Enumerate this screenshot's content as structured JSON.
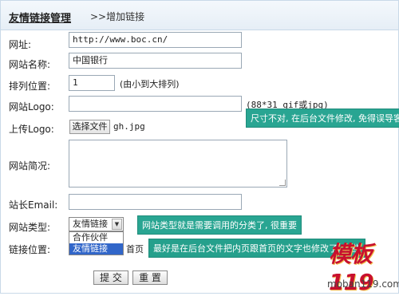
{
  "header": {
    "title": "友情链接管理",
    "subtitle": ">>增加链接"
  },
  "fields": {
    "url": {
      "label": "网址:",
      "value": "http://www.boc.cn/"
    },
    "site_name": {
      "label": "网站名称:",
      "value": "中国银行"
    },
    "order": {
      "label": "排列位置:",
      "value": "1",
      "hint": "(由小到大排列)"
    },
    "logo": {
      "label": "网站Logo:",
      "value": "",
      "hint": "(88*31 gif或jpg)"
    },
    "upload": {
      "label": "上传Logo:",
      "button": "选择文件",
      "filename": "gh.jpg"
    },
    "intro": {
      "label": "网站简况:",
      "value": ""
    },
    "email": {
      "label": "站长Email:",
      "value": ""
    },
    "type": {
      "label": "网站类型:",
      "selected": "友情链接",
      "options": [
        "合作伙伴",
        "友情链接"
      ]
    },
    "position": {
      "label": "链接位置:",
      "radio_label": "首页"
    }
  },
  "tips": {
    "logo_size": "尺寸不对, 在后台文件修改, 免得误导客户",
    "site_type": "网站类型就是需要调用的分类了, 很重要",
    "link_pos": "最好是在后台文件把内页跟首页的文字也修改了, 好些"
  },
  "buttons": {
    "submit": "提 交",
    "reset": "重 置"
  },
  "watermark": {
    "text": "模板119",
    "url": "moban119.com"
  }
}
